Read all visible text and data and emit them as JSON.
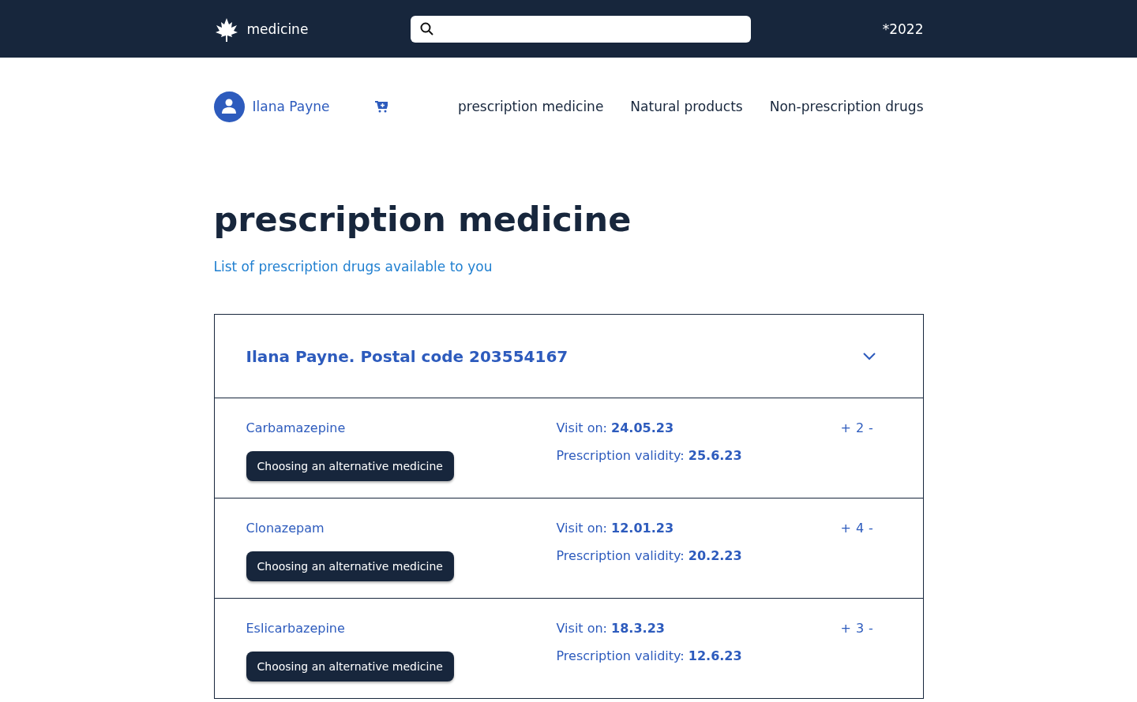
{
  "header": {
    "brand": "medicine",
    "year": "*2022"
  },
  "user": {
    "name": "Ilana Payne"
  },
  "nav": [
    {
      "label": "prescription medicine",
      "selected": false
    },
    {
      "label": "Natural products",
      "selected": false
    },
    {
      "label": "Non-prescription drugs",
      "selected": false
    }
  ],
  "page": {
    "title": "prescription medicine",
    "subtitle": "List of prescription drugs available to you"
  },
  "patient": {
    "title": "Ilana Payne. Postal code 203554167",
    "expanded": true,
    "drugs": [
      {
        "name": "Carbamazepine",
        "button": "Choosing an alternative medicine",
        "visit": "Visit on: **24.05.23**",
        "validity": "Prescription validity: **25.6.23**",
        "plus": "+",
        "quantity": "2",
        "minus": "-"
      },
      {
        "name": "Clonazepam",
        "button": "Choosing an alternative medicine",
        "visit": "Visit on: **12.01.23**",
        "validity": "Prescription validity: **20.2.23**",
        "plus": "+",
        "quantity": "4",
        "minus": "-"
      },
      {
        "name": "Eslicarbazepine",
        "button": "Choosing an alternative medicine",
        "visit": "Visit on: **18.3.23**",
        "validity": "Prescription validity: **12.6.23**",
        "plus": "+",
        "quantity": "3",
        "minus": "-"
      }
    ]
  }
}
